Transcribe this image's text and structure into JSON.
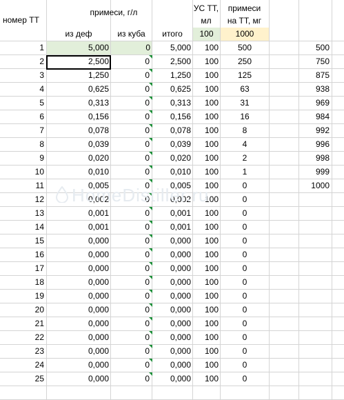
{
  "headers": {
    "number": "номер ТТ",
    "impurities": "примеси, г/л",
    "from_def": "из деф",
    "from_cube": "из куба",
    "total": "итого",
    "us_tt_line1": "УС ТТ,",
    "us_tt_line2": "мл",
    "imp_tt_line1": "примеси",
    "imp_tt_line2": "на ТТ, мг"
  },
  "params": {
    "us_tt": "100",
    "imp_tt": "1000"
  },
  "rows": [
    {
      "n": "1",
      "def": "5,000",
      "cube": "0",
      "total": "5,000",
      "us": "100",
      "imp": "500",
      "cum": "500"
    },
    {
      "n": "2",
      "def": "2,500",
      "cube": "0",
      "total": "2,500",
      "us": "100",
      "imp": "250",
      "cum": "750"
    },
    {
      "n": "3",
      "def": "1,250",
      "cube": "0",
      "total": "1,250",
      "us": "100",
      "imp": "125",
      "cum": "875"
    },
    {
      "n": "4",
      "def": "0,625",
      "cube": "0",
      "total": "0,625",
      "us": "100",
      "imp": "63",
      "cum": "938"
    },
    {
      "n": "5",
      "def": "0,313",
      "cube": "0",
      "total": "0,313",
      "us": "100",
      "imp": "31",
      "cum": "969"
    },
    {
      "n": "6",
      "def": "0,156",
      "cube": "0",
      "total": "0,156",
      "us": "100",
      "imp": "16",
      "cum": "984"
    },
    {
      "n": "7",
      "def": "0,078",
      "cube": "0",
      "total": "0,078",
      "us": "100",
      "imp": "8",
      "cum": "992"
    },
    {
      "n": "8",
      "def": "0,039",
      "cube": "0",
      "total": "0,039",
      "us": "100",
      "imp": "4",
      "cum": "996"
    },
    {
      "n": "9",
      "def": "0,020",
      "cube": "0",
      "total": "0,020",
      "us": "100",
      "imp": "2",
      "cum": "998"
    },
    {
      "n": "10",
      "def": "0,010",
      "cube": "0",
      "total": "0,010",
      "us": "100",
      "imp": "1",
      "cum": "999"
    },
    {
      "n": "11",
      "def": "0,005",
      "cube": "0",
      "total": "0,005",
      "us": "100",
      "imp": "0",
      "cum": "1000"
    },
    {
      "n": "12",
      "def": "0,002",
      "cube": "0",
      "total": "0,002",
      "us": "100",
      "imp": "0",
      "cum": ""
    },
    {
      "n": "13",
      "def": "0,001",
      "cube": "0",
      "total": "0,001",
      "us": "100",
      "imp": "0",
      "cum": ""
    },
    {
      "n": "14",
      "def": "0,001",
      "cube": "0",
      "total": "0,001",
      "us": "100",
      "imp": "0",
      "cum": ""
    },
    {
      "n": "15",
      "def": "0,000",
      "cube": "0",
      "total": "0,000",
      "us": "100",
      "imp": "0",
      "cum": ""
    },
    {
      "n": "16",
      "def": "0,000",
      "cube": "0",
      "total": "0,000",
      "us": "100",
      "imp": "0",
      "cum": ""
    },
    {
      "n": "17",
      "def": "0,000",
      "cube": "0",
      "total": "0,000",
      "us": "100",
      "imp": "0",
      "cum": ""
    },
    {
      "n": "18",
      "def": "0,000",
      "cube": "0",
      "total": "0,000",
      "us": "100",
      "imp": "0",
      "cum": ""
    },
    {
      "n": "19",
      "def": "0,000",
      "cube": "0",
      "total": "0,000",
      "us": "100",
      "imp": "0",
      "cum": ""
    },
    {
      "n": "20",
      "def": "0,000",
      "cube": "0",
      "total": "0,000",
      "us": "100",
      "imp": "0",
      "cum": ""
    },
    {
      "n": "21",
      "def": "0,000",
      "cube": "0",
      "total": "0,000",
      "us": "100",
      "imp": "0",
      "cum": ""
    },
    {
      "n": "22",
      "def": "0,000",
      "cube": "0",
      "total": "0,000",
      "us": "100",
      "imp": "0",
      "cum": ""
    },
    {
      "n": "23",
      "def": "0,000",
      "cube": "0",
      "total": "0,000",
      "us": "100",
      "imp": "0",
      "cum": ""
    },
    {
      "n": "24",
      "def": "0,000",
      "cube": "0",
      "total": "0,000",
      "us": "100",
      "imp": "0",
      "cum": ""
    },
    {
      "n": "25",
      "def": "0,000",
      "cube": "0",
      "total": "0,000",
      "us": "100",
      "imp": "0",
      "cum": ""
    }
  ],
  "watermark": "HomeDistiller.ru",
  "colors": {
    "green_fill": "#e2efda",
    "yellow_fill": "#fff2cc",
    "error_marker": "#1e8f3a",
    "grid": "#d4d4d4"
  }
}
